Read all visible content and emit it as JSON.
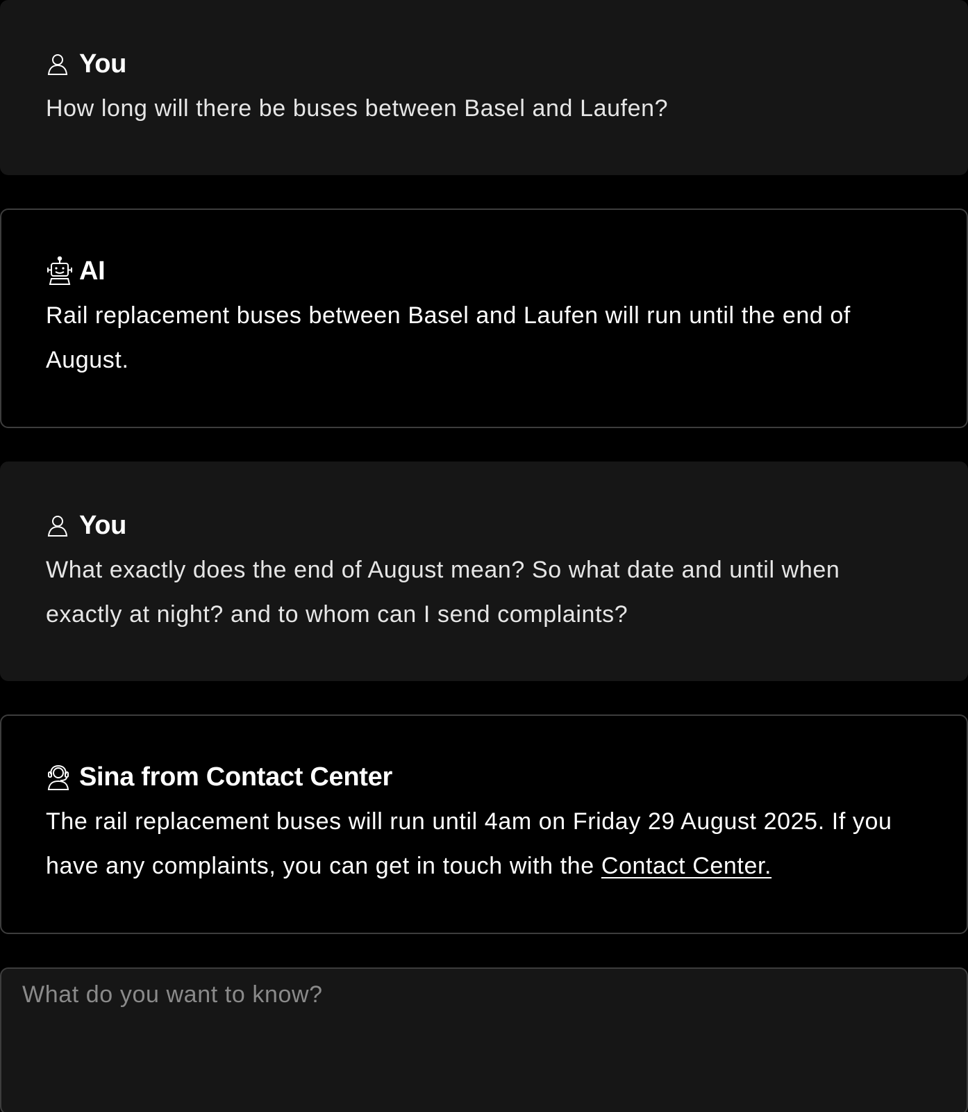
{
  "messages": [
    {
      "role": "user",
      "author": "You",
      "icon": "user-icon",
      "text": "How long will there be buses between Basel and Laufen?"
    },
    {
      "role": "ai",
      "author": "AI",
      "icon": "robot-icon",
      "text": "Rail replacement buses between Basel and Laufen will run until the end of August."
    },
    {
      "role": "user",
      "author": "You",
      "icon": "user-icon",
      "text": "What exactly does the end of August mean? So what date and until when exactly at night? and to whom can I send complaints?"
    },
    {
      "role": "agent",
      "author": "Sina from Contact Center",
      "icon": "support-agent-icon",
      "text": "The rail replacement buses will run until 4am on Friday 29 August 2025. If you have any complaints, you can get in touch with the ",
      "link_text": "Contact Center."
    }
  ],
  "composer": {
    "placeholder": "What do you want to know?",
    "value": ""
  },
  "colors": {
    "background": "#000000",
    "user_bubble": "#161616",
    "agent_border": "#3d3d3d",
    "text": "#ffffff",
    "placeholder": "#8a8a8a"
  }
}
